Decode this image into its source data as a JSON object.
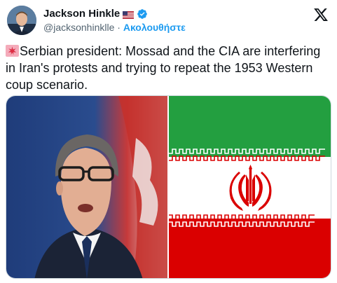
{
  "author": {
    "display_name": "Jackson Hinkle",
    "handle": "@jacksonhinklle",
    "separator": "·",
    "follow_label": "Ακολουθήστε",
    "flag_icon": "us-flag-icon",
    "verified_icon": "verified-badge-icon"
  },
  "tweet": {
    "siren_icon": "rotating-light-icon",
    "text": "Serbian president:  Mossad and the CIA are interfering in Iran's protests and trying to repeat the 1953 Western coup scenario."
  },
  "media": {
    "left_image": "photo of Serbian president in front of Serbian flag",
    "right_image": "flag of Iran"
  },
  "colors": {
    "link": "#1d9bf0",
    "text": "#0f1419",
    "muted": "#536471",
    "iran_green": "#239f40",
    "iran_red": "#da0000"
  }
}
